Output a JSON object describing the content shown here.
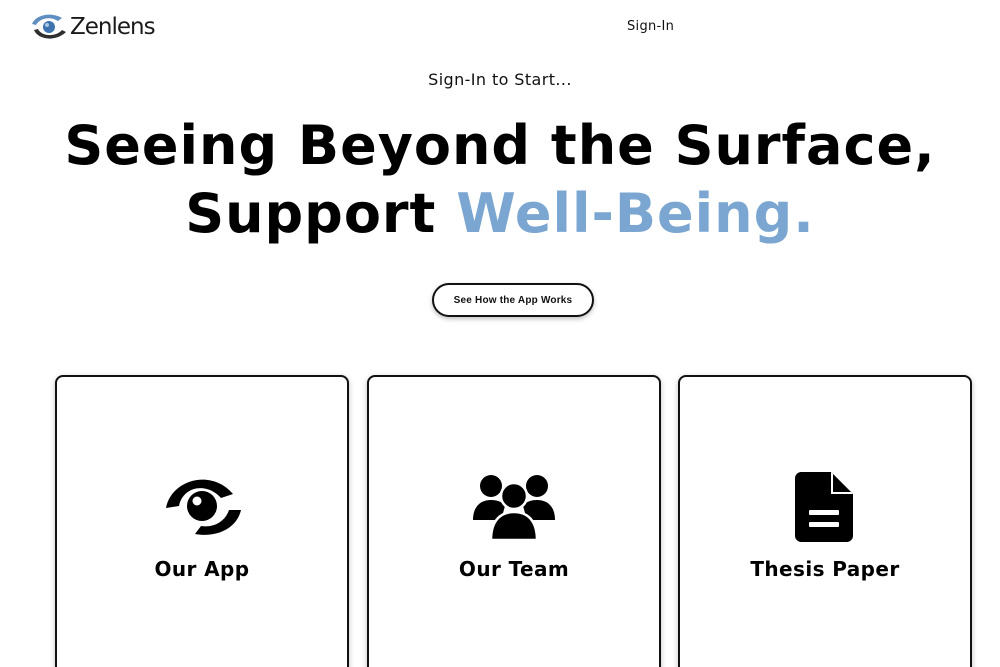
{
  "header": {
    "brand": "Zenlens",
    "signin_label": "Sign-In"
  },
  "hero": {
    "kicker": "Sign-In to Start...",
    "headline_line1": "Seeing Beyond the Surface,",
    "headline_line2_prefix": "Support ",
    "headline_line2_accent": "Well-Being.",
    "cta_label": "See How the App Works"
  },
  "cards": [
    {
      "title": "Our App",
      "icon": "eye-icon"
    },
    {
      "title": "Our Team",
      "icon": "team-icon"
    },
    {
      "title": "Thesis Paper",
      "icon": "document-icon"
    }
  ],
  "colors": {
    "accent": "#7aa6d1",
    "text": "#000000",
    "background": "#ffffff"
  }
}
